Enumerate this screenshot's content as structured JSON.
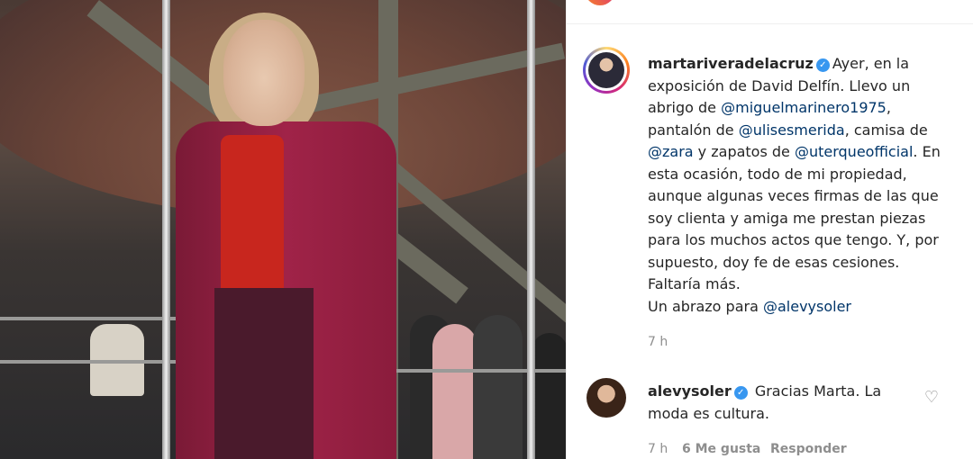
{
  "post": {
    "author": "martariveradelacruz",
    "verified_icon": "verified-badge-icon",
    "caption_parts": {
      "p1": "Ayer, en la exposición de David Delfín. Llevo un abrigo de ",
      "m1": "@miguelmarinero1975",
      "p2": ", pantalón de ",
      "m2": "@ulisesmerida",
      "p3": ", camisa de ",
      "m3": "@zara",
      "p4": " y zapatos de ",
      "m4": "@uterqueofficial",
      "p5": ". En esta ocasión, todo de mi propiedad, aunque algunas veces firmas de las que soy clienta y amiga me prestan piezas para los muchos actos que tengo. Y, por supuesto, doy fe de esas cesiones. Faltaría más.",
      "p6": "Un abrazo para ",
      "m5": "@alevysoler"
    },
    "time": "7 h"
  },
  "reply": {
    "author": "alevysoler",
    "text": "Gracias Marta. La moda es cultura.",
    "time": "7 h",
    "likes": "6 Me gusta",
    "reply_label": "Responder",
    "like_icon": "heart-icon"
  },
  "colors": {
    "mention": "#003569",
    "verified": "#3897f0",
    "meta": "#8e8e8e"
  }
}
